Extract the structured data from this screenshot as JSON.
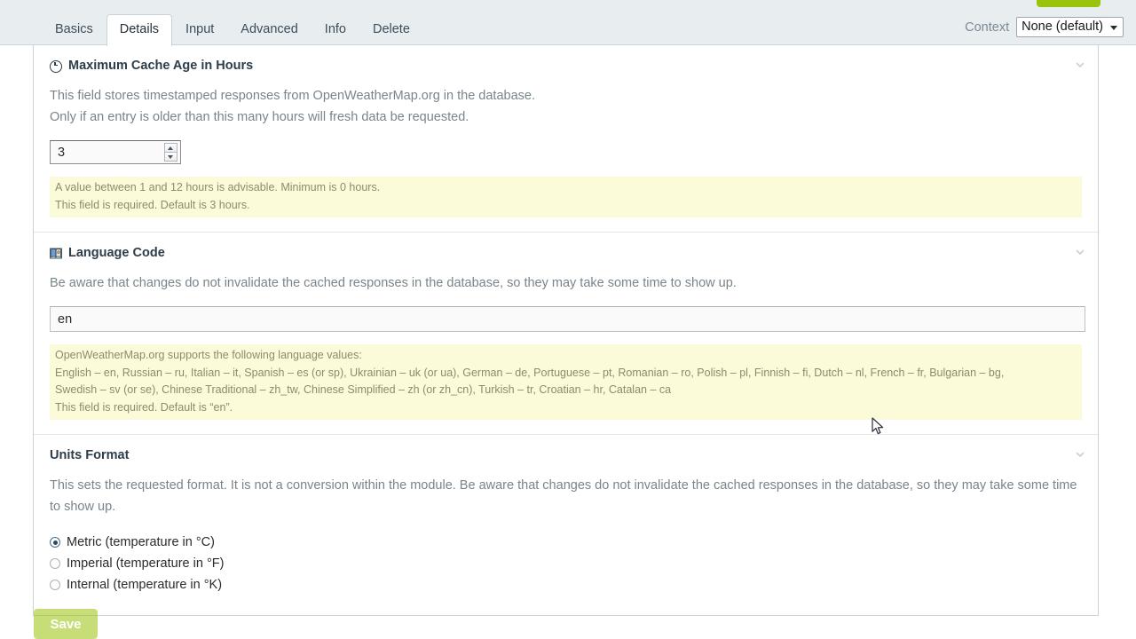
{
  "topbar": {
    "tabs": [
      {
        "label": "Basics",
        "active": false
      },
      {
        "label": "Details",
        "active": true
      },
      {
        "label": "Input",
        "active": false
      },
      {
        "label": "Advanced",
        "active": false
      },
      {
        "label": "Info",
        "active": false
      },
      {
        "label": "Delete",
        "active": false
      }
    ],
    "context_label": "Context",
    "context_value": "None (default)",
    "top_save_color": "#9ac40a"
  },
  "sections": {
    "cache": {
      "icon": "clock-icon",
      "title": "Maximum Cache Age in Hours",
      "desc_line1": "This field stores timestamped responses from OpenWeatherMap.org in the database.",
      "desc_line2": "Only if an entry is older than this many hours will fresh data be requested.",
      "value": "3",
      "note_line1": "A value between 1 and 12 hours is advisable. Minimum is 0 hours.",
      "note_line2": "This field is required. Default is 3 hours."
    },
    "language": {
      "icon": "language-book-icon",
      "title": "Language Code",
      "desc": "Be aware that changes do not invalidate the cached responses in the database, so they may take some time to show up.",
      "value": "en",
      "note_line1": "OpenWeatherMap.org supports the following language values:",
      "note_line2": "English – en, Russian – ru, Italian – it, Spanish – es (or sp), Ukrainian – uk (or ua), German – de, Portuguese – pt, Romanian – ro, Polish – pl, Finnish – fi, Dutch – nl, French – fr, Bulgarian – bg,",
      "note_line3": "Swedish – sv (or se), Chinese Traditional – zh_tw, Chinese Simplified – zh (or zh_cn), Turkish – tr, Croatian – hr, Catalan – ca",
      "note_line4": "This field is required. Default is “en”."
    },
    "units": {
      "title": "Units Format",
      "desc": "This sets the requested format. It is not a conversion within the module. Be aware that changes do not invalidate the cached responses in the database, so they may take some time to show up.",
      "options": [
        {
          "label": "Metric (temperature in °C)",
          "checked": true
        },
        {
          "label": "Imperial (temperature in °F)",
          "checked": false
        },
        {
          "label": "Internal (temperature in °K)",
          "checked": false
        }
      ]
    }
  },
  "footer": {
    "save_label": "Save",
    "save_color": "#9ac40a"
  },
  "colors": {
    "topbar_bg": "#e8edf0",
    "panel_border": "#c8d4da",
    "note_bg": "#fbfbda",
    "note_text": "#8e8a6d",
    "desc_text": "#79848b",
    "heading_text": "#2d3d49",
    "chevron": "#c3d2db"
  }
}
